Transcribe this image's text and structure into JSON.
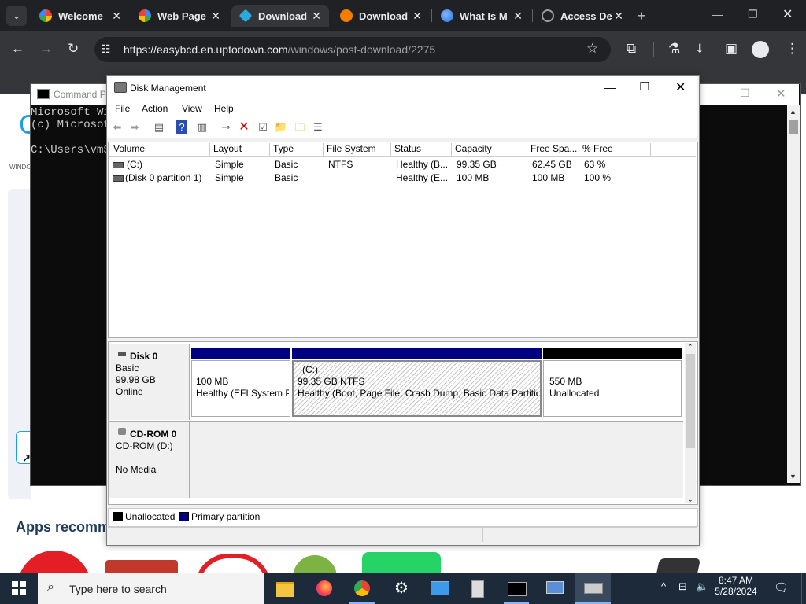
{
  "browser": {
    "tabs": [
      {
        "label": "Welcome",
        "icon": "google-photos-icon",
        "color": "#fbbc05",
        "active": false
      },
      {
        "label": "Web Page",
        "icon": "google-photos-icon",
        "color": "#4285f4",
        "active": false
      },
      {
        "label": "Download",
        "icon": "uptodown-icon",
        "color": "#29a9e0",
        "active": true
      },
      {
        "label": "Download",
        "icon": "ccleaner-icon",
        "color": "#f57c00",
        "active": false
      },
      {
        "label": "What Is M",
        "icon": "globe-icon",
        "color": "#8ab4f8",
        "active": false
      },
      {
        "label": "Access De",
        "icon": "globe-icon",
        "color": "#9aa0a6",
        "active": false
      }
    ],
    "url_host": "https://easybcd.en.uptodown.com",
    "url_path": "/windows/post-download/2275"
  },
  "webpage": {
    "left_text": "WINDO",
    "apps_heading": "Apps recomm"
  },
  "cmd": {
    "title": "Command P",
    "lines": [
      "Microsoft Wi",
      "(c) Microsof",
      "",
      "C:\\Users\\vmS"
    ]
  },
  "disk_management": {
    "title": "Disk Management",
    "menu": [
      "File",
      "Action",
      "View",
      "Help"
    ],
    "columns": [
      "Volume",
      "Layout",
      "Type",
      "File System",
      "Status",
      "Capacity",
      "Free Spa...",
      "% Free"
    ],
    "rows": [
      [
        "(C:)",
        "Simple",
        "Basic",
        "NTFS",
        "Healthy (B...",
        "99.35 GB",
        "62.45 GB",
        "63 %"
      ],
      [
        "(Disk 0 partition 1)",
        "Simple",
        "Basic",
        "",
        "Healthy (E...",
        "100 MB",
        "100 MB",
        "100 %"
      ]
    ],
    "disks": [
      {
        "name": "Disk 0",
        "type": "Basic",
        "size": "99.98 GB",
        "status": "Online",
        "partitions": [
          {
            "label": "",
            "size": "100 MB",
            "desc": "Healthy (EFI System P",
            "kind": "primary"
          },
          {
            "label": "(C:)",
            "size": "99.35 GB NTFS",
            "desc": "Healthy (Boot, Page File, Crash Dump, Basic Data Partition",
            "kind": "primary-selected"
          },
          {
            "label": "",
            "size": "550 MB",
            "desc": "Unallocated",
            "kind": "unallocated"
          }
        ]
      },
      {
        "name": "CD-ROM 0",
        "type": "CD-ROM (D:)",
        "size": "",
        "status": "No Media"
      }
    ],
    "legend": [
      {
        "label": "Unallocated",
        "color": "#000000"
      },
      {
        "label": "Primary partition",
        "color": "#000080"
      }
    ]
  },
  "taskbar": {
    "search_placeholder": "Type here to search",
    "time": "8:47 AM",
    "date": "5/28/2024"
  }
}
